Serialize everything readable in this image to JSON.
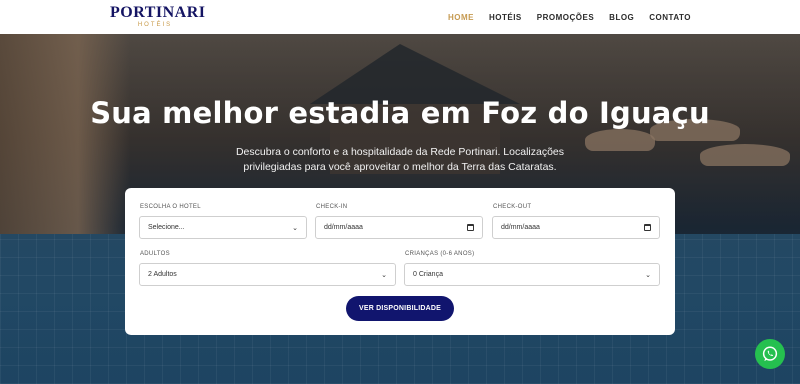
{
  "brand": {
    "name": "PORTINARI",
    "sub": "HOTÉIS"
  },
  "nav": [
    {
      "label": "HOME",
      "active": true
    },
    {
      "label": "HOTÉIS"
    },
    {
      "label": "PROMOÇÕES"
    },
    {
      "label": "BLOG"
    },
    {
      "label": "CONTATO"
    }
  ],
  "hero": {
    "title": "Sua melhor estadia em Foz do Iguaçu",
    "subtitle": "Descubra o conforto e a hospitalidade da Rede Portinari. Localizações privilegiadas para você aproveitar o melhor da Terra das Cataratas."
  },
  "booking": {
    "hotel": {
      "label": "ESCOLHA O HOTEL",
      "value": "Selecione..."
    },
    "checkin": {
      "label": "CHECK-IN",
      "value": "dd/mm/aaaa"
    },
    "checkout": {
      "label": "CHECK-OUT",
      "value": "dd/mm/aaaa"
    },
    "adults": {
      "label": "ADULTOS",
      "value": "2 Adultos"
    },
    "children": {
      "label": "CRIANÇAS (0-6 ANOS)",
      "value": "0 Criança"
    },
    "submit_label": "VER DISPONIBILIDADE"
  },
  "colors": {
    "brand": "#141463",
    "accent": "#c69a51",
    "button": "#11156e",
    "whatsapp": "#25c04f"
  },
  "icons": {
    "whatsapp": "whatsapp-icon",
    "calendar": "calendar-icon",
    "dropdown": "chevron-down-icon"
  }
}
